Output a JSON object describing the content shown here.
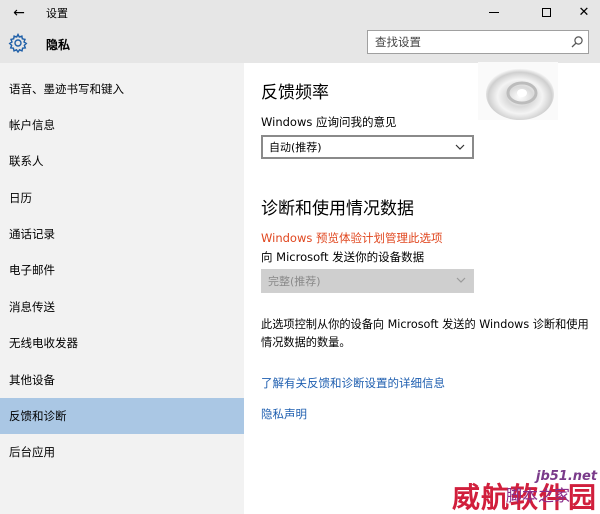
{
  "window": {
    "title": "设置",
    "back_symbol": "←",
    "close_symbol": "✕"
  },
  "header": {
    "title": "隐私",
    "search_placeholder": "查找设置"
  },
  "sidebar": {
    "items": [
      {
        "label": "语音、墨迹书写和键入"
      },
      {
        "label": "帐户信息"
      },
      {
        "label": "联系人"
      },
      {
        "label": "日历"
      },
      {
        "label": "通话记录"
      },
      {
        "label": "电子邮件"
      },
      {
        "label": "消息传送"
      },
      {
        "label": "无线电收发器"
      },
      {
        "label": "其他设备"
      },
      {
        "label": "反馈和诊断"
      },
      {
        "label": "后台应用"
      }
    ],
    "active": "反馈和诊断"
  },
  "content": {
    "feedback_title": "反馈频率",
    "feedback_label": "Windows 应询问我的意见",
    "feedback_value": "自动(推荐)",
    "diag_title": "诊断和使用情况数据",
    "diag_warning": "Windows 预览体验计划管理此选项",
    "diag_label": "向 Microsoft 发送你的设备数据",
    "diag_value": "完整(推荐)",
    "diag_desc": "此选项控制从你的设备向 Microsoft 发送的 Windows 诊断和使用情况数据的数量。",
    "link_more": "了解有关反馈和诊断设置的详细信息",
    "link_privacy": "隐私声明"
  },
  "watermark": {
    "site": "jb51.net",
    "big": "威航软件园",
    "small": "脚本之家"
  },
  "colors": {
    "chrome": "#e6e6e6",
    "sidebar": "#f2f2f2",
    "active": "#aac7e4",
    "warning": "#e0461e",
    "link": "#1f5fb0"
  }
}
